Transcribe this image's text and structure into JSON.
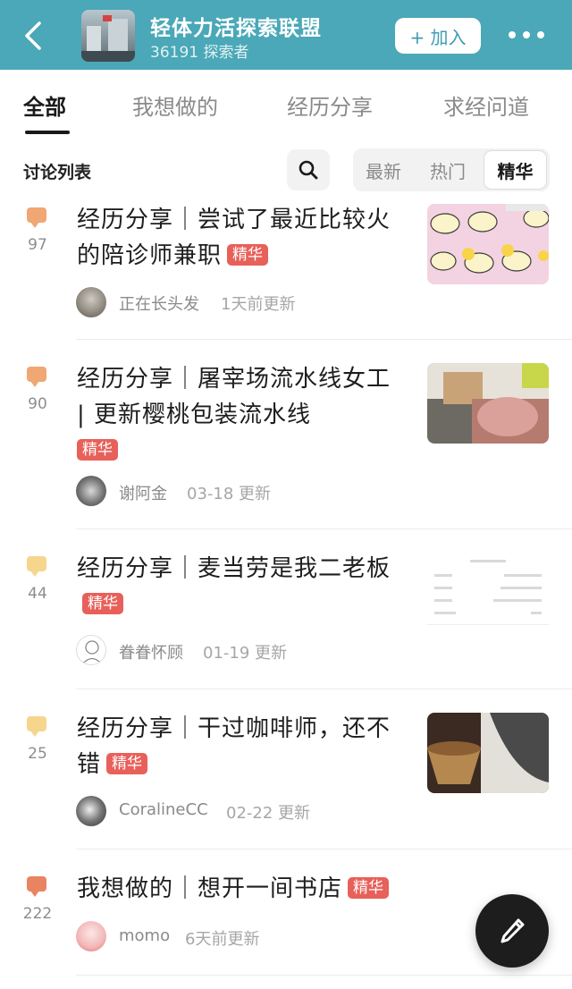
{
  "header": {
    "title": "轻体力活探索联盟",
    "members": "36191 探索者",
    "join_label": "+ 加入",
    "colors": {
      "bar": "#4aa8b8"
    }
  },
  "tabs": [
    "全部",
    "我想做的",
    "经历分享",
    "求经问道"
  ],
  "toolbar": {
    "list_title": "讨论列表",
    "sort_options": [
      "最新",
      "热门",
      "精华"
    ],
    "active_sort": "精华"
  },
  "posts": [
    {
      "count": "97",
      "title": "经历分享｜尝试了最近比较火的陪诊师兼职",
      "badge": "精华",
      "author": "正在长头发",
      "time": "1天前更新"
    },
    {
      "count": "90",
      "title": "经历分享｜屠宰场流水线女工 | 更新樱桃包装流水线",
      "badge": "精华",
      "author": "谢阿金",
      "time": "03-18 更新"
    },
    {
      "count": "44",
      "title": "经历分享｜麦当劳是我二老板",
      "badge": "精华",
      "author": "眷眷怀顾",
      "time": "01-19 更新"
    },
    {
      "count": "25",
      "title": "经历分享｜干过咖啡师，还不错",
      "badge": "精华",
      "author": "CoralineCC",
      "time": "02-22 更新"
    },
    {
      "count": "222",
      "title": "我想做的｜想开一间书店",
      "badge": "精华",
      "author": "momo",
      "time": "6天前更新"
    }
  ],
  "icons": {
    "back": "chevron-left-icon",
    "more": "more-dots-icon",
    "search": "search-icon",
    "comment": "comment-bubble-icon",
    "compose": "pen-icon"
  },
  "colors": {
    "badge": "#e8605a",
    "bubble_dark": "#f0a773",
    "bubble_light": "#f6d58d",
    "bubble_red": "#e98462"
  }
}
